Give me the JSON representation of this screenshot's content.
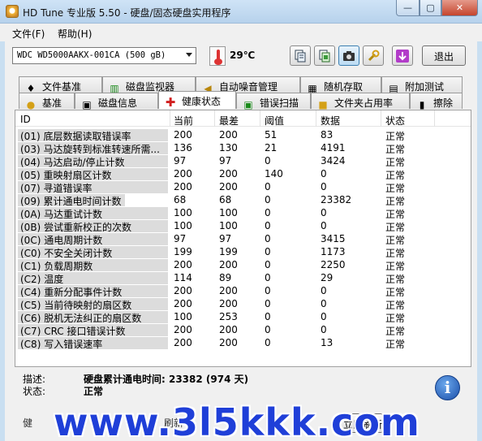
{
  "window": {
    "title": "HD Tune 专业版 5.50 - 硬盘/固态硬盘实用程序",
    "min": "—",
    "max": "▢",
    "close": "✕"
  },
  "menu": {
    "file": "文件(F)",
    "help": "帮助(H)"
  },
  "toolbar": {
    "drive": "WDC WD5000AAKX-001CA (500 gB)",
    "temperature": "29℃",
    "exit_label": "退出",
    "buttons": [
      "copy-text-icon",
      "copy-screen-icon",
      "camera-icon",
      "tools-icon",
      "download-icon"
    ]
  },
  "tabs_top": [
    {
      "label": "文件基准",
      "icon": "file-benchmark-icon"
    },
    {
      "label": "磁盘监视器",
      "icon": "disk-monitor-icon"
    },
    {
      "label": "自动噪音管理",
      "icon": "speaker-icon"
    },
    {
      "label": "随机存取",
      "icon": "random-access-icon"
    },
    {
      "label": "附加测试",
      "icon": "extra-tests-icon"
    }
  ],
  "tabs_bottom": [
    {
      "label": "基准",
      "icon": "bulb-icon"
    },
    {
      "label": "磁盘信息",
      "icon": "disk-info-icon"
    },
    {
      "label": "健康状态",
      "icon": "health-cross-icon"
    },
    {
      "label": "错误扫描",
      "icon": "error-scan-icon"
    },
    {
      "label": "文件夹占用率",
      "icon": "folder-icon"
    },
    {
      "label": "擦除",
      "icon": "trash-icon"
    }
  ],
  "table": {
    "headers": {
      "id": "ID",
      "current": "当前",
      "worst": "最差",
      "threshold": "阈值",
      "data": "数据",
      "status": "状态"
    },
    "rows": [
      {
        "id": "(01) 底层数据读取错误率",
        "current": "200",
        "worst": "200",
        "threshold": "51",
        "data": "83",
        "status": "正常"
      },
      {
        "id": "(03) 马达旋转到标准转速所需...",
        "current": "136",
        "worst": "130",
        "threshold": "21",
        "data": "4191",
        "status": "正常"
      },
      {
        "id": "(04) 马达启动/停止计数",
        "current": "97",
        "worst": "97",
        "threshold": "0",
        "data": "3424",
        "status": "正常"
      },
      {
        "id": "(05) 重映射扇区计数",
        "current": "200",
        "worst": "200",
        "threshold": "140",
        "data": "0",
        "status": "正常"
      },
      {
        "id": "(07) 寻道错误率",
        "current": "200",
        "worst": "200",
        "threshold": "0",
        "data": "0",
        "status": "正常"
      },
      {
        "id": "(09) 累计通电时间计数",
        "current": "68",
        "worst": "68",
        "threshold": "0",
        "data": "23382",
        "status": "正常"
      },
      {
        "id": "(0A) 马达重试计数",
        "current": "100",
        "worst": "100",
        "threshold": "0",
        "data": "0",
        "status": "正常"
      },
      {
        "id": "(0B) 尝试重新校正的次数",
        "current": "100",
        "worst": "100",
        "threshold": "0",
        "data": "0",
        "status": "正常"
      },
      {
        "id": "(0C) 通电周期计数",
        "current": "97",
        "worst": "97",
        "threshold": "0",
        "data": "3415",
        "status": "正常"
      },
      {
        "id": "(C0) 不安全关闭计数",
        "current": "199",
        "worst": "199",
        "threshold": "0",
        "data": "1173",
        "status": "正常"
      },
      {
        "id": "(C1) 负载周期数",
        "current": "200",
        "worst": "200",
        "threshold": "0",
        "data": "2250",
        "status": "正常"
      },
      {
        "id": "(C2) 温度",
        "current": "114",
        "worst": "89",
        "threshold": "0",
        "data": "29",
        "status": "正常"
      },
      {
        "id": "(C4) 重新分配事件计数",
        "current": "200",
        "worst": "200",
        "threshold": "0",
        "data": "0",
        "status": "正常"
      },
      {
        "id": "(C5) 当前待映射的扇区数",
        "current": "200",
        "worst": "200",
        "threshold": "0",
        "data": "0",
        "status": "正常"
      },
      {
        "id": "(C6) 脱机无法纠正的扇区数",
        "current": "100",
        "worst": "253",
        "threshold": "0",
        "data": "0",
        "status": "正常"
      },
      {
        "id": "(C7) CRC 接口错误计数",
        "current": "200",
        "worst": "200",
        "threshold": "0",
        "data": "0",
        "status": "正常"
      },
      {
        "id": "(C8) 写入错误速率",
        "current": "200",
        "worst": "200",
        "threshold": "0",
        "data": "13",
        "status": "正常"
      }
    ]
  },
  "details": {
    "desc_label": "描述:",
    "desc_value": "硬盘累计通电时间: 23382 (974 天)",
    "status_label": "状态:",
    "status_value": "正常",
    "info_glyph": "i"
  },
  "bottom": {
    "health_partial": "健",
    "refresh_partial": "刷新",
    "now_button": "立即刷新"
  },
  "watermark": "www.3l5kkk.com",
  "colors": {
    "accent_blue": "#1f3fd8",
    "health_red": "#d11f1f"
  }
}
